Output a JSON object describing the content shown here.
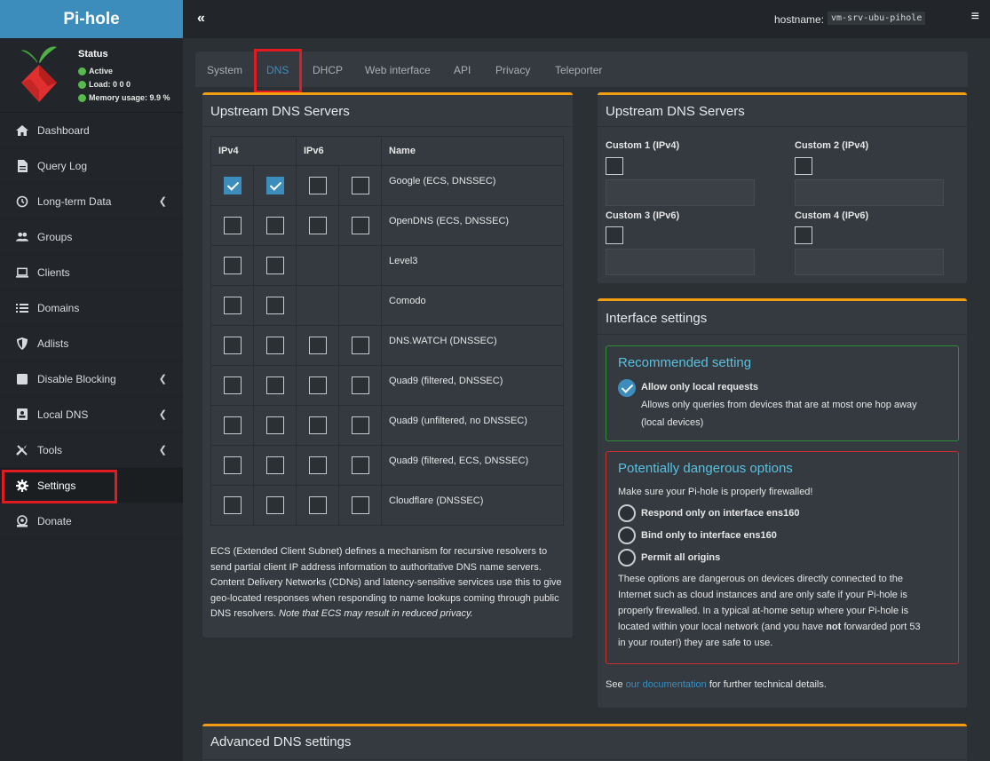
{
  "app": {
    "title": "Pi-hole"
  },
  "status": {
    "title": "Status",
    "active": "Active",
    "load": "Load:  0  0  0",
    "memory": "Memory usage:  9.9 %"
  },
  "sidebar": {
    "items": [
      {
        "label": "Dashboard",
        "icon": "home-icon"
      },
      {
        "label": "Query Log",
        "icon": "file-icon"
      },
      {
        "label": "Long-term Data",
        "icon": "history-icon"
      },
      {
        "label": "Groups",
        "icon": "users-icon"
      },
      {
        "label": "Clients",
        "icon": "laptop-icon"
      },
      {
        "label": "Domains",
        "icon": "list-icon"
      },
      {
        "label": "Adlists",
        "icon": "shield-icon"
      },
      {
        "label": "Disable Blocking",
        "icon": "stop-icon"
      },
      {
        "label": "Local DNS",
        "icon": "address-card-icon"
      },
      {
        "label": "Tools",
        "icon": "tools-icon"
      },
      {
        "label": "Settings",
        "icon": "gear-icon"
      },
      {
        "label": "Donate",
        "icon": "donate-icon"
      }
    ]
  },
  "topbar": {
    "collapse": "«",
    "hostname_label": "hostname:",
    "hostname": "vm-srv-ubu-pihole",
    "menu": "≡"
  },
  "tabs": [
    "System",
    "DNS",
    "DHCP",
    "Web interface",
    "API",
    "Privacy",
    "Teleporter"
  ],
  "upstream": {
    "title": "Upstream DNS Servers",
    "headers": {
      "ipv4": "IPv4",
      "ipv6": "IPv6",
      "name": "Name"
    },
    "rows": [
      {
        "name": "Google (ECS, DNSSEC)",
        "v4a": true,
        "v4b": true,
        "v6": true
      },
      {
        "name": "OpenDNS (ECS, DNSSEC)",
        "v4a": false,
        "v4b": false,
        "v6": true
      },
      {
        "name": "Level3",
        "v4a": false,
        "v4b": false,
        "v6": false
      },
      {
        "name": "Comodo",
        "v4a": false,
        "v4b": false,
        "v6": false
      },
      {
        "name": "DNS.WATCH (DNSSEC)",
        "v4a": false,
        "v4b": false,
        "v6": true
      },
      {
        "name": "Quad9 (filtered, DNSSEC)",
        "v4a": false,
        "v4b": false,
        "v6": true
      },
      {
        "name": "Quad9 (unfiltered, no DNSSEC)",
        "v4a": false,
        "v4b": false,
        "v6": true
      },
      {
        "name": "Quad9 (filtered, ECS, DNSSEC)",
        "v4a": false,
        "v4b": false,
        "v6": true
      },
      {
        "name": "Cloudflare (DNSSEC)",
        "v4a": false,
        "v4b": false,
        "v6": true
      }
    ],
    "ecs_text": "ECS (Extended Client Subnet) defines a mechanism for recursive resolvers to send partial client IP address information to authoritative DNS name servers. Content Delivery Networks (CDNs) and latency-sensitive services use this to give geo-located responses when responding to name lookups coming through public DNS resolvers.",
    "ecs_note": "Note that ECS may result in reduced privacy."
  },
  "custom": {
    "title": "Upstream DNS Servers",
    "c1": "Custom 1 (IPv4)",
    "c2": "Custom 2 (IPv4)",
    "c3": "Custom 3 (IPv6)",
    "c4": "Custom 4 (IPv6)"
  },
  "interface": {
    "title": "Interface settings",
    "recommended_title": "Recommended setting",
    "local_label": "Allow only local requests",
    "local_desc1": "Allows only queries from devices that are at most one hop away",
    "local_desc2": "(local devices)",
    "danger_title": "Potentially dangerous options",
    "firewall_note": "Make sure your Pi-hole is properly firewalled!",
    "opt1": "Respond only on interface ens160",
    "opt2": "Bind only to interface ens160",
    "opt3": "Permit all origins",
    "warn1": "These options are dangerous on devices directly connected to the",
    "warn2": "Internet such as cloud instances and are only safe if your Pi-hole is",
    "warn3": "properly firewalled. In a typical at-home setup where your Pi-hole is",
    "warn4a": "located within your local network (and you have ",
    "warn4b": "not",
    "warn4c": " forwarded port 53",
    "warn5": "in your router!) they are safe to use.",
    "see": "See ",
    "doc_link": "our documentation",
    "see_after": " for further technical details."
  },
  "advanced": {
    "title": "Advanced DNS settings"
  },
  "colors": {
    "accent": "#3c8dbc",
    "brand": "#3c8dbc",
    "panel_border": "#f39c12",
    "highlight": "#e21b23"
  }
}
